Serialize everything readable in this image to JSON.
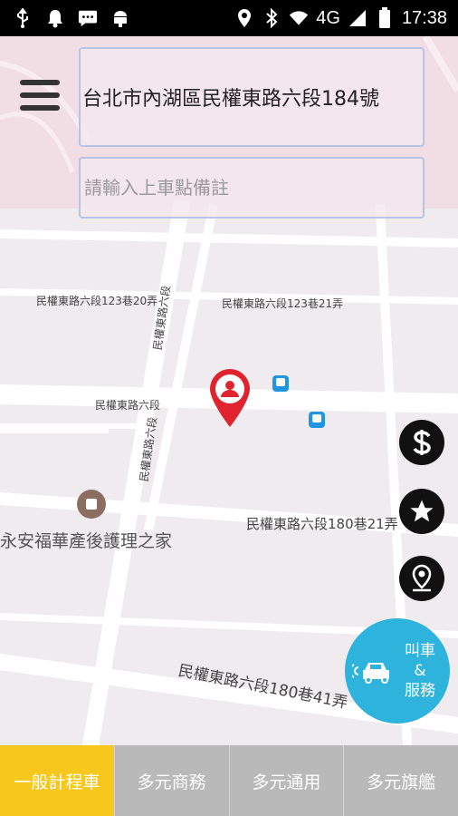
{
  "status_bar": {
    "network": "4G",
    "time": "17:38",
    "left_icons": [
      "usb-icon",
      "bell-icon",
      "message-icon",
      "android-icon"
    ],
    "right_icons": [
      "location-icon",
      "bluetooth-icon",
      "wifi-icon",
      "signal-icon",
      "battery-icon"
    ]
  },
  "pickup": {
    "address": "台北市內湖區民權東路六段184號",
    "note_placeholder": "請輸入上車點備註",
    "note_value": ""
  },
  "map": {
    "labels": {
      "lane_20": "民權東路六段123巷20弄",
      "lane_21": "民權東路六段123巷21弄",
      "road_main": "民權東路六段",
      "lane_180_21": "民權東路六段180巷21弄",
      "lane_180_41": "民權東路六段180巷41弄",
      "vertical_road_1": "民權東路六段",
      "vertical_road_2": "民權東路六段",
      "poi_nursing": "永安福華產後護理之家"
    }
  },
  "side_buttons": [
    "fare-icon",
    "favorite-star-icon",
    "saved-location-icon"
  ],
  "call_button": {
    "label": "叫車\n&\n服務"
  },
  "tabs": [
    {
      "label": "一般計程車",
      "active": true
    },
    {
      "label": "多元商務",
      "active": false
    },
    {
      "label": "多元通用",
      "active": false
    },
    {
      "label": "多元旗艦",
      "active": false
    }
  ],
  "colors": {
    "active_tab": "#f6c81e",
    "inactive_tab": "#b9b9b9",
    "call_button": "#2eb3dd",
    "pin": "#e0242f",
    "bus_stop": "#2196e0"
  }
}
